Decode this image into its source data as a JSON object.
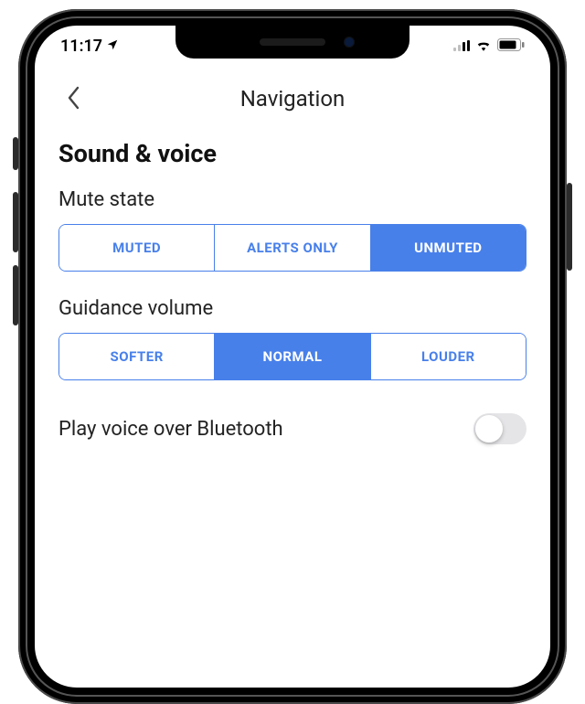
{
  "status": {
    "time": "11:17",
    "location_active": true
  },
  "navbar": {
    "title": "Navigation",
    "back_icon": "chevron-left"
  },
  "section": {
    "heading": "Sound & voice"
  },
  "mute_state": {
    "label": "Mute state",
    "options": [
      "MUTED",
      "ALERTS ONLY",
      "UNMUTED"
    ],
    "selected": "UNMUTED"
  },
  "guidance_volume": {
    "label": "Guidance volume",
    "options": [
      "SOFTER",
      "NORMAL",
      "LOUDER"
    ],
    "selected": "NORMAL"
  },
  "bluetooth_row": {
    "label": "Play voice over Bluetooth",
    "toggle_on": false
  },
  "colors": {
    "accent": "#4880ea"
  }
}
